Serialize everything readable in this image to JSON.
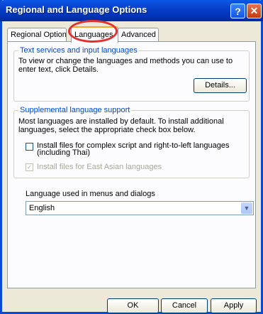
{
  "window": {
    "title": "Regional and Language Options"
  },
  "titlebar_buttons": {
    "help": "?",
    "close": "✕"
  },
  "tabs": [
    {
      "label": "Regional Options"
    },
    {
      "label": "Languages"
    },
    {
      "label": "Advanced"
    }
  ],
  "text_services": {
    "legend": "Text services and input languages",
    "description": "To view or change the languages and methods you can use to enter text, click Details.",
    "details_button": "Details..."
  },
  "supplemental": {
    "legend": "Supplemental language support",
    "description": "Most languages are installed by default. To install additional languages, select the appropriate check box below.",
    "complex_script": {
      "label": "Install files for complex script and right-to-left languages (including Thai)",
      "checked": false
    },
    "east_asian": {
      "label": "Install files for East Asian languages",
      "checked": true,
      "disabled": true
    }
  },
  "ui_language": {
    "label": "Language used in menus and dialogs",
    "selected": "English"
  },
  "footer": {
    "ok": "OK",
    "cancel": "Cancel",
    "apply": "Apply"
  },
  "annotation": {
    "color": "#e03030"
  }
}
